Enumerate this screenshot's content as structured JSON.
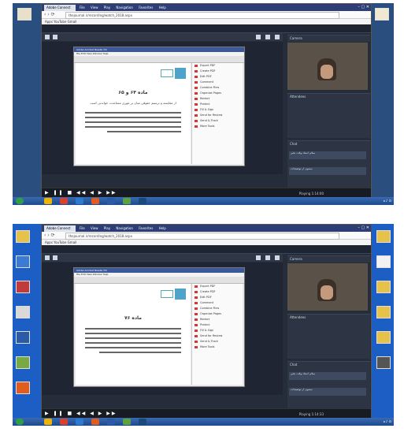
{
  "screens": [
    {
      "id": "s1",
      "doc_heading": "ماده ۶۴ و ۶۵",
      "doc_sub": "از مقایسه و ترسیم حقوقی میان بر تئوری مساعدت خواندنی است"
    },
    {
      "id": "s2",
      "doc_heading": "ماده ۷۶",
      "doc_sub": ""
    }
  ],
  "browser": {
    "tab_label": "Adobe Connect",
    "menu": [
      "File",
      "View",
      "Play",
      "Navigation",
      "Favorites",
      "Help"
    ],
    "url": "thejournal.ir/recording/watch_2018.aspx",
    "bookmarks": "Apps   YouTube   Gmail"
  },
  "pdf": {
    "title": "Adobe Acrobat Reader DC",
    "menu": "File  Edit  View  Window  Help"
  },
  "pdf_side_items": [
    "Export PDF",
    "Create PDF",
    "Edit PDF",
    "Comment",
    "Combine Files",
    "Organize Pages",
    "Redact",
    "Protect",
    "Fill & Sign",
    "Send for Review",
    "Send & Track",
    "More Tools"
  ],
  "player": {
    "controls": "▶ ❚❚ ■  ◀◀ ◀ ▶ ▶▶",
    "time_s1": "Playing 1:14:00",
    "time_s2": "Playing 1:14:33"
  },
  "panels": {
    "camera": "Camera",
    "attendees": "Attendees",
    "chat": "Chat",
    "chat_msg1": "سلام استاد وقت بخیر",
    "chat_msg2": "ممنون از توضیحات"
  },
  "colors": {
    "app_bg": "#252c3a",
    "desktop_s2": "#1d5ec4",
    "taskbar": "#1d4a8f"
  }
}
